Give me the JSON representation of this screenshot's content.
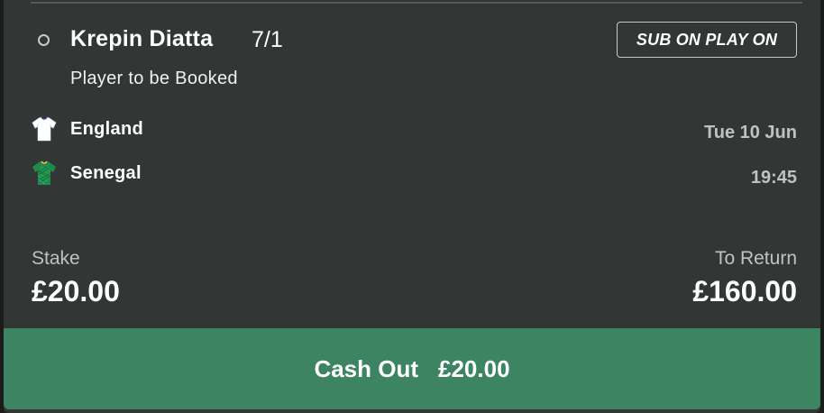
{
  "bet": {
    "selection": "Krepin Diatta",
    "odds": "7/1",
    "market": "Player to be Booked",
    "sub_on_label": "SUB ON PLAY ON"
  },
  "match": {
    "home_team": "England",
    "away_team": "Senegal",
    "date": "Tue 10 Jun",
    "time": "19:45"
  },
  "summary": {
    "stake_label": "Stake",
    "stake_value": "£20.00",
    "return_label": "To Return",
    "return_value": "£160.00"
  },
  "cashout": {
    "label": "Cash Out",
    "amount": "£20.00"
  },
  "colors": {
    "card_bg": "#323634",
    "cashout_green": "#3d8462"
  },
  "icons": [
    "england-shirt-icon",
    "senegal-shirt-icon"
  ]
}
